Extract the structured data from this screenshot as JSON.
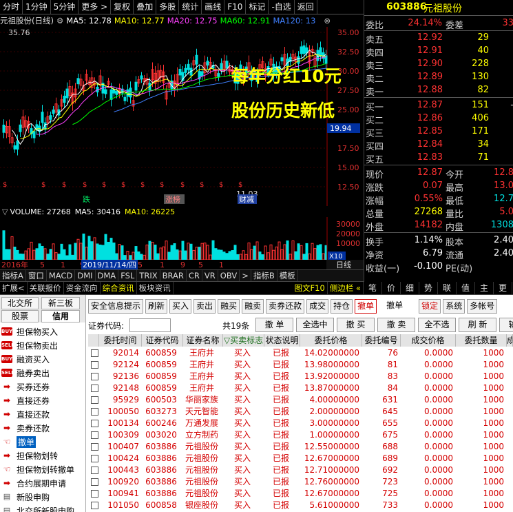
{
  "toolbar": {
    "items": [
      "分时",
      "1分钟",
      "5分钟",
      "更多 >",
      "复权",
      "叠加",
      "多股",
      "统计",
      "画线",
      "F10",
      "标记",
      "-自选",
      "返回"
    ]
  },
  "chart": {
    "title": "元祖股份(日线)",
    "ma5": "MA5: 12.78",
    "ma10": "MA10: 12.77",
    "ma20": "MA20: 12.75",
    "ma60": "MA60: 12.91",
    "ma120": "MA120: 13",
    "y_ticks": [
      "35.00",
      "32.50",
      "30.00",
      "27.50",
      "25.00",
      "22.50",
      "17.50",
      "15.00",
      "12.50"
    ],
    "price_tag": "19.94",
    "high_label": "35.76",
    "low_label": "11.03",
    "annotation1": "每年分红10元",
    "annotation2": "股份历史新低",
    "event1": "跌",
    "event2": "涨榜",
    "event3": "财减",
    "colors": {
      "up": "#ff3232",
      "down": "#00e0e0",
      "ma5": "#ffffff",
      "ma10": "#ffff00",
      "ma20": "#ff40ff",
      "ma60": "#00ff00",
      "ma120": "#4080ff",
      "annotation": "#ffff00"
    }
  },
  "volume": {
    "label": "VOLUME: 27268",
    "ma5": "MA5: 30416",
    "ma10": "MA10: 26225",
    "y_ticks": [
      "30000",
      "20000",
      "10000"
    ],
    "unit": "X10"
  },
  "date_axis": {
    "labels": [
      "2016年",
      "5",
      "1",
      "9",
      "2019/11/14/四",
      "5",
      "1",
      "9",
      "5",
      "1"
    ],
    "right_label": "日线"
  },
  "indicator_tabs": [
    "指标A",
    "窗口",
    "MACD",
    "DMI",
    "DMA",
    "FSL",
    "TRIX",
    "BRAR",
    "CR",
    "VR",
    "OBV",
    ">",
    "指标B",
    "模板"
  ],
  "ext_tabs": [
    "扩展<",
    "关联报价",
    "资金流向",
    "综合资讯",
    "板块资讯",
    "图文F10",
    "侧边栏 «"
  ],
  "quote": {
    "code": "603886",
    "name": "元祖股份",
    "weibi_label": "委比",
    "weibi": "24.14%",
    "weicha_label": "委差",
    "weicha": "33",
    "asks": [
      {
        "label": "卖五",
        "price": "12.92",
        "vol": "29"
      },
      {
        "label": "卖四",
        "price": "12.91",
        "vol": "40"
      },
      {
        "label": "卖三",
        "price": "12.90",
        "vol": "228"
      },
      {
        "label": "卖二",
        "price": "12.89",
        "vol": "130"
      },
      {
        "label": "卖一",
        "price": "12.88",
        "vol": "82"
      }
    ],
    "bids": [
      {
        "label": "买一",
        "price": "12.87",
        "vol": "151",
        "chg": "-"
      },
      {
        "label": "买二",
        "price": "12.86",
        "vol": "406",
        "chg": ""
      },
      {
        "label": "买三",
        "price": "12.85",
        "vol": "171",
        "chg": ""
      },
      {
        "label": "买四",
        "price": "12.84",
        "vol": "34",
        "chg": ""
      },
      {
        "label": "买五",
        "price": "12.83",
        "vol": "71",
        "chg": ""
      }
    ],
    "stats": [
      {
        "l1": "现价",
        "v1": "12.87",
        "l2": "今开",
        "v2": "12.8"
      },
      {
        "l1": "涨跌",
        "v1": "0.07",
        "l2": "最高",
        "v2": "13.0"
      },
      {
        "l1": "涨幅",
        "v1": "0.55%",
        "l2": "最低",
        "v2": "12.7"
      },
      {
        "l1": "总量",
        "v1": "27268",
        "l2": "量比",
        "v2": "5.0"
      },
      {
        "l1": "外盘",
        "v1": "14182",
        "l2": "内盘",
        "v2": "1308"
      }
    ],
    "stats2": [
      {
        "l1": "换手",
        "v1": "1.14%",
        "l2": "股本",
        "v2": "2.40"
      },
      {
        "l1": "净资",
        "v1": "6.79",
        "l2": "流通",
        "v2": "2.40"
      },
      {
        "l1": "收益(一)",
        "v1": "-0.100",
        "l2": "PE(动)",
        "v2": ""
      }
    ]
  },
  "side_tabs": [
    "笔",
    "价",
    "细",
    "势",
    "联",
    "值",
    "主",
    "更"
  ],
  "account_tabs": {
    "tab1": "北交所",
    "tab2": "新三板",
    "tab3": "股票",
    "tab4": "信用"
  },
  "menu": [
    {
      "label": "担保物买入",
      "icon": "BUY"
    },
    {
      "label": "担保物卖出",
      "icon": "SELL"
    },
    {
      "label": "融资买入",
      "icon": "BUY"
    },
    {
      "label": "融券卖出",
      "icon": "SELL"
    },
    {
      "label": "买券还券",
      "icon": "arrow"
    },
    {
      "label": "直接还券",
      "icon": "arrow"
    },
    {
      "label": "直接还款",
      "icon": "arrow"
    },
    {
      "label": "卖券还款",
      "icon": "arrow"
    },
    {
      "label": "撤单",
      "icon": "hand"
    },
    {
      "label": "担保物划转",
      "icon": "arrow"
    },
    {
      "label": "担保物划转撤单",
      "icon": "hand"
    },
    {
      "label": "合约展期申请",
      "icon": "arrow"
    },
    {
      "label": "新股申购",
      "icon": "doc"
    },
    {
      "label": "北交所新股申购",
      "icon": "doc"
    }
  ],
  "buttons": [
    "安全信息提示",
    "刷新",
    "买入",
    "卖出",
    "融买",
    "融卖",
    "卖券还款",
    "成交",
    "持仓",
    "撤单",
    "撤单",
    "锁定",
    "系统",
    "多帐号"
  ],
  "codebar": {
    "label": "证券代码:",
    "count": "共19条",
    "actions": [
      "撤 单",
      "全选中",
      "撤 买",
      "撤 卖",
      "全不选",
      "刷 新",
      "输 出"
    ]
  },
  "grid": {
    "headers": [
      "",
      "委托时间",
      "证券代码",
      "证券名称",
      "▽买卖标志",
      "状态说明",
      "委托价格",
      "委托编号",
      "成交价格",
      "委托数量",
      "成"
    ],
    "rows": [
      [
        "92014",
        "600859",
        "王府井",
        "买入",
        "已报",
        "14.02000000",
        "76",
        "0.0000",
        "1000"
      ],
      [
        "92124",
        "600859",
        "王府井",
        "买入",
        "已报",
        "13.98000000",
        "81",
        "0.0000",
        "1000"
      ],
      [
        "92136",
        "600859",
        "王府井",
        "买入",
        "已报",
        "13.92000000",
        "83",
        "0.0000",
        "1000"
      ],
      [
        "92148",
        "600859",
        "王府井",
        "买入",
        "已报",
        "13.87000000",
        "84",
        "0.0000",
        "1000"
      ],
      [
        "95929",
        "600503",
        "华丽家族",
        "买入",
        "已报",
        "4.00000000",
        "631",
        "0.0000",
        "1000"
      ],
      [
        "100050",
        "603273",
        "天元智能",
        "买入",
        "已报",
        "2.00000000",
        "645",
        "0.0000",
        "1000"
      ],
      [
        "100134",
        "600246",
        "万通发展",
        "买入",
        "已报",
        "3.00000000",
        "655",
        "0.0000",
        "1000"
      ],
      [
        "100309",
        "003020",
        "立方制药",
        "买入",
        "已报",
        "1.00000000",
        "675",
        "0.0000",
        "1000"
      ],
      [
        "100407",
        "603886",
        "元祖股份",
        "买入",
        "已报",
        "12.55000000",
        "688",
        "0.0000",
        "1000"
      ],
      [
        "100424",
        "603886",
        "元祖股份",
        "买入",
        "已报",
        "12.67000000",
        "689",
        "0.0000",
        "1000"
      ],
      [
        "100443",
        "603886",
        "元祖股份",
        "买入",
        "已报",
        "12.71000000",
        "692",
        "0.0000",
        "1000"
      ],
      [
        "100920",
        "603886",
        "元祖股份",
        "买入",
        "已报",
        "12.76000000",
        "723",
        "0.0000",
        "1000"
      ],
      [
        "100941",
        "603886",
        "元祖股份",
        "买入",
        "已报",
        "12.67000000",
        "725",
        "0.0000",
        "1000"
      ],
      [
        "101050",
        "600858",
        "银座股份",
        "买入",
        "已报",
        "5.61000000",
        "733",
        "0.0000",
        "1000"
      ]
    ]
  }
}
